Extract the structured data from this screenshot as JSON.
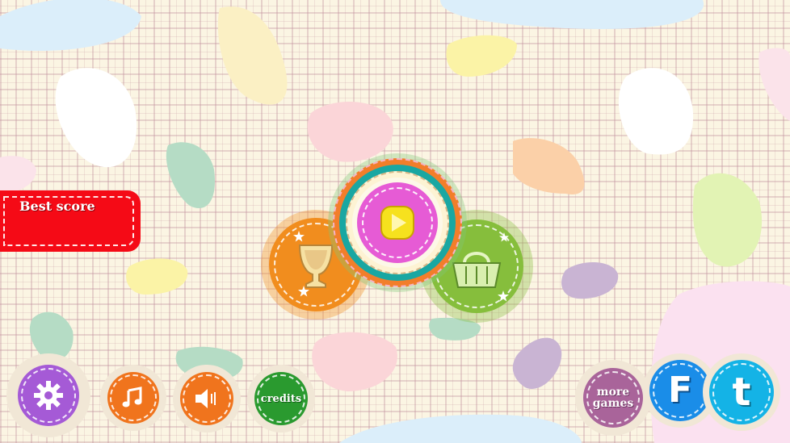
{
  "best_score": {
    "label": "Best score"
  },
  "buttons": {
    "play": {
      "icon": "play-icon"
    },
    "trophy": {
      "icon": "trophy-cup-icon"
    },
    "shop": {
      "icon": "basket-icon"
    },
    "settings": {
      "icon": "gear-icon"
    },
    "music": {
      "icon": "music-note-icon"
    },
    "sound": {
      "icon": "speaker-icon"
    },
    "credits": {
      "label": "credits"
    },
    "more_games": {
      "label_line1": "more",
      "label_line2": "games"
    },
    "facebook": {
      "label": "F"
    },
    "twitter": {
      "label": "t"
    }
  },
  "colors": {
    "play_inner": "#e65bd5",
    "play_button": "#f6e11e",
    "trophy": "#f18d1e",
    "shop": "#86be3c",
    "settings": "#a55ad6",
    "music": "#f0741d",
    "sound": "#f0741d",
    "credits": "#2a9a2f",
    "more_games": "#a9649a",
    "facebook": "#1a8de8",
    "twitter": "#14b3e6",
    "banner": "#f50a16"
  }
}
